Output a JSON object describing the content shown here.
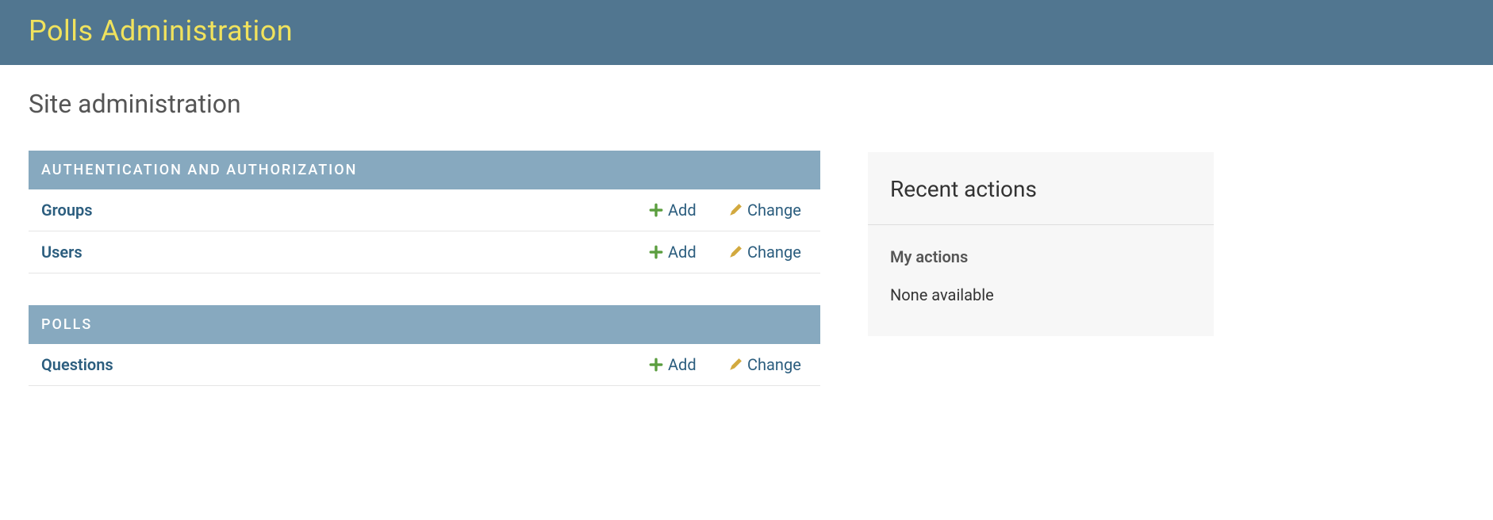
{
  "header": {
    "title": "Polls Administration"
  },
  "page": {
    "title": "Site administration"
  },
  "modules": [
    {
      "caption": "AUTHENTICATION AND AUTHORIZATION",
      "models": [
        {
          "name": "Groups",
          "add_label": "Add",
          "change_label": "Change"
        },
        {
          "name": "Users",
          "add_label": "Add",
          "change_label": "Change"
        }
      ]
    },
    {
      "caption": "POLLS",
      "models": [
        {
          "name": "Questions",
          "add_label": "Add",
          "change_label": "Change"
        }
      ]
    }
  ],
  "sidebar": {
    "recent_actions_title": "Recent actions",
    "my_actions_title": "My actions",
    "empty_text": "None available"
  }
}
